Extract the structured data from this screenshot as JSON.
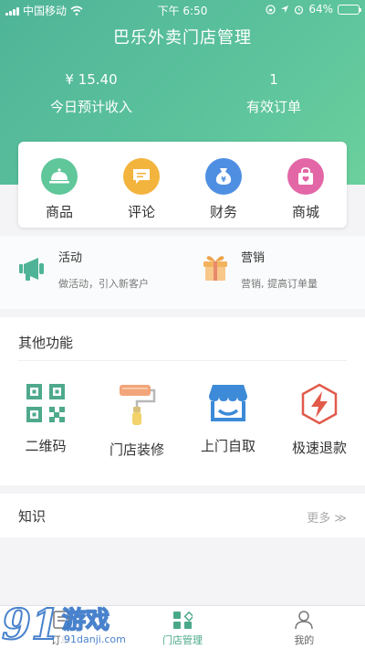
{
  "status_bar": {
    "carrier": "中国移动",
    "time": "下午 6:50",
    "battery": "64%",
    "battery_level": 0.64
  },
  "header": {
    "title": "巴乐外卖门店管理",
    "income_value": "¥ 15.40",
    "income_label": "今日预计收入",
    "orders_value": "1",
    "orders_label": "有效订单"
  },
  "quick_menu": [
    {
      "label": "商品",
      "icon": "dining-bell-icon",
      "color": "#5fc79a"
    },
    {
      "label": "评论",
      "icon": "comment-icon",
      "color": "#f3b43e"
    },
    {
      "label": "财务",
      "icon": "money-bag-icon",
      "color": "#4f8fe2"
    },
    {
      "label": "商城",
      "icon": "shopping-bag-icon",
      "color": "#e367a6"
    }
  ],
  "promo": {
    "activity": {
      "title": "活动",
      "desc": "做活动，引入新客户",
      "icon": "megaphone-icon"
    },
    "marketing": {
      "title": "营销",
      "desc": "营销, 提高订单量",
      "icon": "gift-icon"
    }
  },
  "other_functions": {
    "title": "其他功能",
    "items": [
      {
        "label": "二维码",
        "icon": "qr-code-icon"
      },
      {
        "label": "门店装修",
        "icon": "paint-roller-icon"
      },
      {
        "label": "上门自取",
        "icon": "storefront-icon"
      },
      {
        "label": "极速退款",
        "icon": "lightning-refund-icon"
      }
    ]
  },
  "knowledge": {
    "title": "知识",
    "more": "更多 ≫"
  },
  "tabbar": [
    {
      "label": "订单",
      "icon": "order-icon",
      "active": false
    },
    {
      "label": "门店管理",
      "icon": "store-manage-icon",
      "active": true
    },
    {
      "label": "我的",
      "icon": "user-icon",
      "active": false
    }
  ],
  "watermark": {
    "logo": "91",
    "name": "游戏",
    "url": "91danji.com"
  }
}
